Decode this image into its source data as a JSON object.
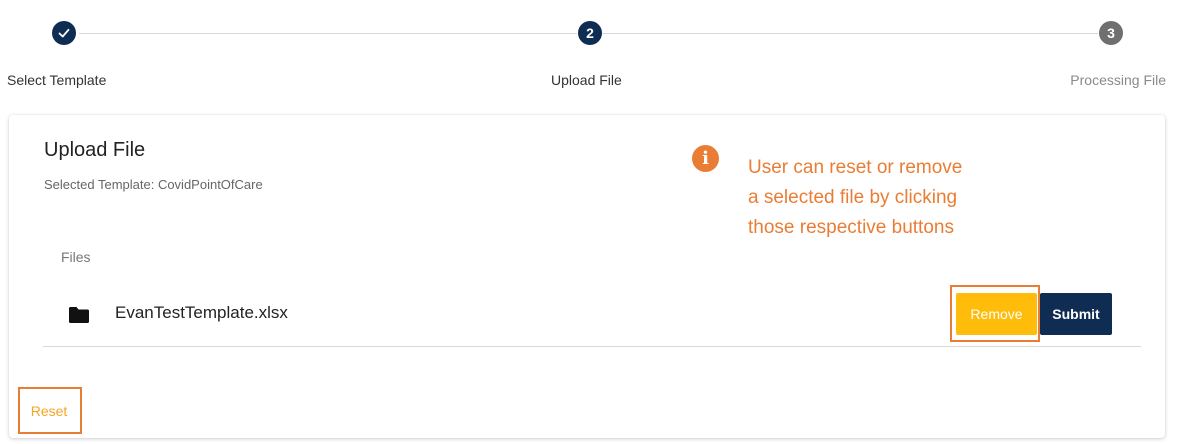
{
  "stepper": {
    "steps": [
      {
        "number": "",
        "label": "Select Template",
        "state": "completed",
        "icon": "check-icon"
      },
      {
        "number": "2",
        "label": "Upload File",
        "state": "active"
      },
      {
        "number": "3",
        "label": "Processing File",
        "state": "pending"
      }
    ]
  },
  "card": {
    "title": "Upload File",
    "subtitle": "Selected Template: CovidPointOfCare",
    "files_label": "Files",
    "files": [
      {
        "name": "EvanTestTemplate.xlsx",
        "icon": "folder-icon"
      }
    ],
    "remove_label": "Remove",
    "submit_label": "Submit",
    "reset_label": "Reset"
  },
  "annotation": {
    "icon": "info-icon",
    "lines": [
      "User can reset or remove",
      "a selected file by clicking",
      "those respective buttons"
    ]
  },
  "colors": {
    "primary": "#0f2c52",
    "warning": "#ffbc0a",
    "annotation": "#ea7d34",
    "pending": "#6f6f6f"
  }
}
